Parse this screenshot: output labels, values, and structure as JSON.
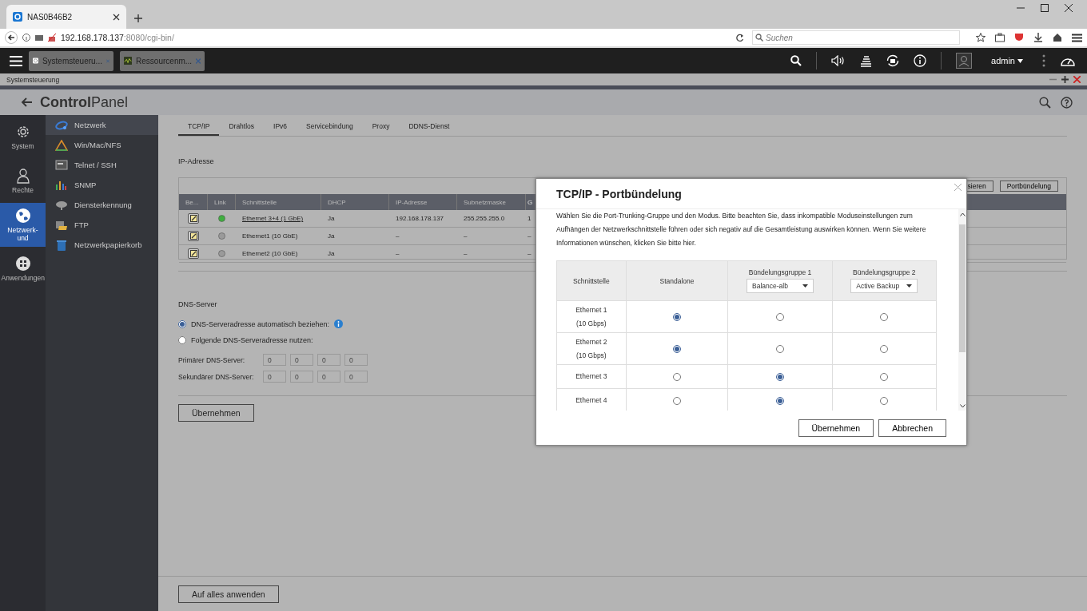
{
  "browser": {
    "tab_title": "NAS0B46B2",
    "url_host": "192.168.178.137",
    "url_rest": ":8080/cgi-bin/",
    "search_placeholder": "Suchen"
  },
  "qts": {
    "apps": [
      {
        "label": "Systemsteueru...",
        "kind": "settings"
      },
      {
        "label": "Ressourcenm...",
        "kind": "monitor"
      }
    ],
    "user": "admin"
  },
  "window": {
    "title": "Systemsteuerung"
  },
  "header": {
    "title": "**Control**Panel"
  },
  "rail": [
    {
      "label": "System",
      "selected": false
    },
    {
      "label": "Rechte",
      "selected": false
    },
    {
      "label": "Netzwerk- und",
      "selected": true
    },
    {
      "label": "Anwendungen",
      "selected": false
    }
  ],
  "sidebar": [
    {
      "label": "Netzwerk",
      "selected": true
    },
    {
      "label": "Win/Mac/NFS",
      "selected": false
    },
    {
      "label": "Telnet / SSH",
      "selected": false
    },
    {
      "label": "SNMP",
      "selected": false
    },
    {
      "label": "Diensterkennung",
      "selected": false
    },
    {
      "label": "FTP",
      "selected": false
    },
    {
      "label": "Netzwerkpapierkorb",
      "selected": false
    }
  ],
  "tabs": [
    {
      "label": "TCP/IP",
      "selected": true
    },
    {
      "label": "Drahtlos",
      "selected": false
    },
    {
      "label": "IPv6",
      "selected": false
    },
    {
      "label": "Servicebindung",
      "selected": false
    },
    {
      "label": "Proxy",
      "selected": false
    },
    {
      "label": "DDNS-Dienst",
      "selected": false
    }
  ],
  "ip_section": {
    "title": "IP-Adresse",
    "toolbar": [
      "sieren",
      "Portbündelung"
    ],
    "columns": [
      "Be...",
      "Link",
      "Schnittstelle",
      "DHCP",
      "IP-Adresse",
      "Subnetzmaske",
      "G"
    ],
    "rows": [
      {
        "link_up": true,
        "interface": "Ethernet 3+4 (1 GbE)",
        "is_link": true,
        "dhcp": "Ja",
        "ip": "192.168.178.137",
        "mask": "255.255.255.0",
        "column_7": "1"
      },
      {
        "link_up": false,
        "interface": "Ethernet1 (10 GbE)",
        "is_link": false,
        "dhcp": "Ja",
        "ip": "–",
        "mask": "–",
        "column_7": "–"
      },
      {
        "link_up": false,
        "interface": "Ethernet2 (10 GbE)",
        "is_link": false,
        "dhcp": "Ja",
        "ip": "–",
        "mask": "–",
        "column_7": "–"
      }
    ]
  },
  "dns": {
    "title": "DNS-Server",
    "options": [
      {
        "label": "DNS-Serveradresse automatisch beziehen:",
        "selected": true,
        "info": true
      },
      {
        "label": "Folgende DNS-Serveradresse nutzen:",
        "selected": false,
        "info": false
      }
    ],
    "servers": [
      {
        "label": "Primärer DNS-Server:",
        "disabled": true,
        "placeholders": [
          "0",
          "0",
          "0",
          "0"
        ]
      },
      {
        "label": "Sekundärer DNS-Server:",
        "disabled": true,
        "placeholders": [
          "0",
          "0",
          "0",
          "0"
        ]
      }
    ],
    "apply": "Übernehmen"
  },
  "footer": {
    "apply_all": "Auf alles anwenden"
  },
  "modal": {
    "title": "TCP/IP - Portbündelung",
    "intro": "Wählen Sie die Port-Trunking-Gruppe und den Modus. Bitte beachten Sie, dass inkompatible Moduseinstellungen zum Aufhängen der Netzwerkschnittstelle führen oder sich negativ auf die Gesamtleistung auswirken können. Wenn Sie weitere Informationen wünschen, klicken Sie bitte hier.",
    "columns": [
      {
        "label": "Schnittstelle"
      },
      {
        "label": "Standalone"
      },
      {
        "label": "Bündelungsgruppe 1",
        "mode": "Balance-alb"
      },
      {
        "label": "Bündelungsgruppe 2",
        "mode": "Active Backup"
      }
    ],
    "rows": [
      {
        "name": "Ethernet 1",
        "speed": "(10 Gbps)",
        "options": [
          {
            "selected": true
          },
          {
            "selected": false
          },
          {
            "selected": false
          }
        ]
      },
      {
        "name": "Ethernet 2",
        "speed": "(10 Gbps)",
        "options": [
          {
            "selected": true
          },
          {
            "selected": false
          },
          {
            "selected": false
          }
        ]
      },
      {
        "name": "Ethernet 3",
        "options": [
          {
            "selected": false
          },
          {
            "selected": true
          },
          {
            "selected": false
          }
        ]
      },
      {
        "name": "Ethernet 4",
        "options": [
          {
            "selected": false
          },
          {
            "selected": true
          },
          {
            "selected": false
          }
        ]
      }
    ],
    "buttons": [
      "Übernehmen",
      "Abbrechen"
    ]
  }
}
